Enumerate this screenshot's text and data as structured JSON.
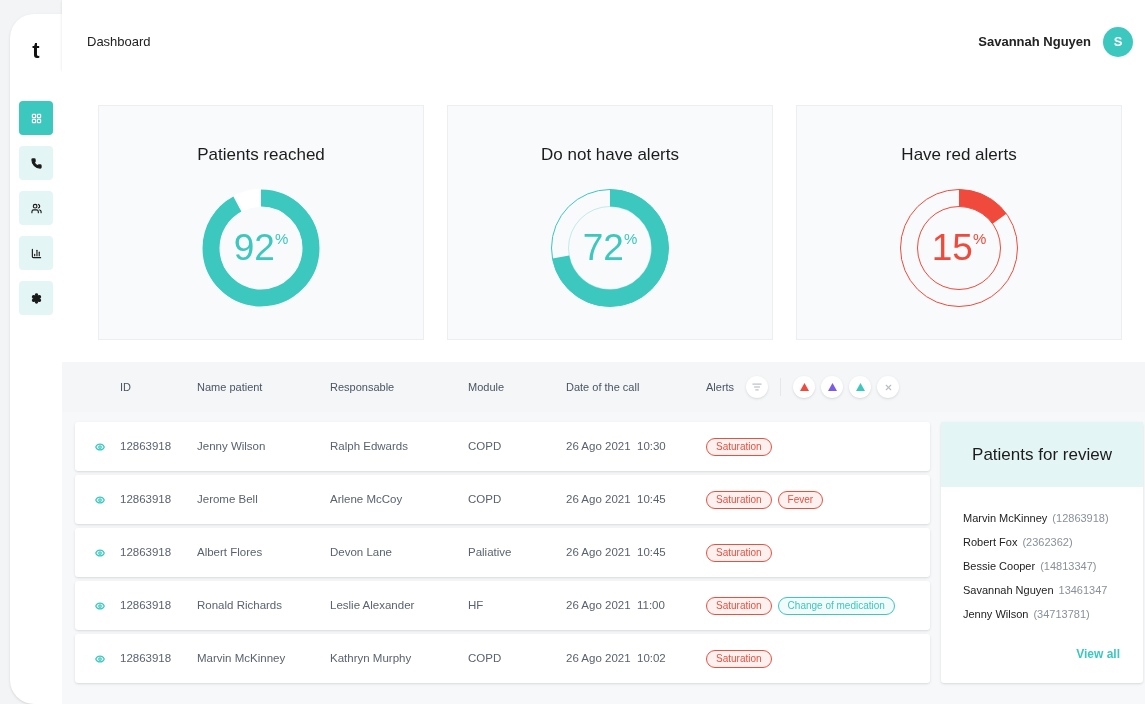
{
  "logo": "t",
  "nav": [
    {
      "kind": "grid",
      "selected": true
    },
    {
      "kind": "phone",
      "selected": false
    },
    {
      "kind": "users",
      "selected": false
    },
    {
      "kind": "chart",
      "selected": false
    },
    {
      "kind": "settings",
      "selected": false
    }
  ],
  "header": {
    "title": "Dashboard",
    "user": {
      "name": "Savannah Nguyen",
      "initial": "S"
    }
  },
  "stats": [
    {
      "title": "Patients reached",
      "value": "92",
      "unit": "%",
      "level": 0.92,
      "kind": "solid",
      "color": "#3cc7bf"
    },
    {
      "title": "Do not have alerts",
      "value": "72",
      "unit": "%",
      "level": 0.72,
      "kind": "outline",
      "color": "#3cc7bf"
    },
    {
      "title": "Have red alerts",
      "value": "15",
      "unit": "%",
      "level": 0.15,
      "kind": "double",
      "color": "#ef4a3c"
    }
  ],
  "table": {
    "columns": [
      "ID",
      "Name patient",
      "Responsable",
      "Module",
      "Date of the call",
      "Alerts"
    ],
    "alert_filters": [
      {
        "kind": "triangle",
        "color": "#ef4a3c"
      },
      {
        "kind": "triangle",
        "color": "#7b5ce6"
      },
      {
        "kind": "triangle",
        "color": "#3cc7bf"
      },
      {
        "kind": "cross",
        "color": "#b8bcc4"
      }
    ],
    "rows": [
      {
        "id": "12863918",
        "name": "Jenny Wilson",
        "responsable": "Ralph Edwards",
        "module": "COPD",
        "date": "26 Ago 2021  10:30",
        "alerts": [
          {
            "label": "Saturation",
            "color": "#e8503f"
          }
        ]
      },
      {
        "id": "12863918",
        "name": "Jerome Bell",
        "responsable": "Arlene McCoy",
        "module": "COPD",
        "date": "26 Ago 2021  10:45",
        "alerts": [
          {
            "label": "Saturation",
            "color": "#e8503f"
          },
          {
            "label": "Fever",
            "color": "#e8503f"
          }
        ]
      },
      {
        "id": "12863918",
        "name": "Albert Flores",
        "responsable": "Devon Lane",
        "module": "Paliative",
        "date": "26 Ago 2021  10:45",
        "alerts": [
          {
            "label": "Saturation",
            "color": "#e8503f"
          }
        ]
      },
      {
        "id": "12863918",
        "name": "Ronald Richards",
        "responsable": "Leslie Alexander",
        "module": "HF",
        "date": "26 Ago 2021  11:00",
        "alerts": [
          {
            "label": "Saturation",
            "color": "#e8503f"
          },
          {
            "label": "Change of medication",
            "color": "#3cc7bf"
          }
        ]
      },
      {
        "id": "12863918",
        "name": "Marvin McKinney",
        "responsable": "Kathryn Murphy",
        "module": "COPD",
        "date": "26 Ago 2021  10:02",
        "alerts": [
          {
            "label": "Saturation",
            "color": "#e8503f"
          }
        ]
      }
    ]
  },
  "review": {
    "title": "Patients for review",
    "patients": [
      {
        "name": "Marvin McKinney",
        "id": "(12863918)"
      },
      {
        "name": "Robert Fox",
        "id": "(2362362)"
      },
      {
        "name": "Bessie Cooper",
        "id": "(14813347)"
      },
      {
        "name": "Savannah Nguyen",
        "id": "13461347"
      },
      {
        "name": "Jenny Wilson",
        "id": "(34713781)"
      }
    ],
    "link": "View all"
  }
}
